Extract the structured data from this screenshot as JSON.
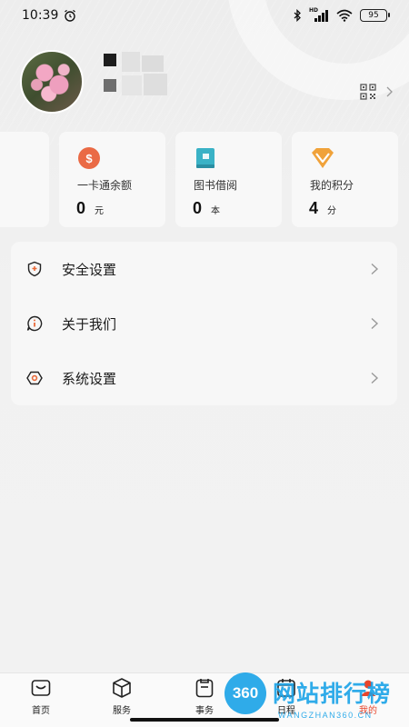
{
  "status_bar": {
    "time": "10:39",
    "battery": "95",
    "network_badge": "HD"
  },
  "profile": {
    "avatar_description": "pink-flowers-photo"
  },
  "stats": [
    {
      "label": "一卡通余额",
      "value": "0",
      "unit": "元",
      "icon": "coin-icon",
      "color": "#ea6a45"
    },
    {
      "label": "图书借阅",
      "value": "0",
      "unit": "本",
      "icon": "book-icon",
      "color": "#3ab2c6"
    },
    {
      "label": "我的积分",
      "value": "4",
      "unit": "分",
      "icon": "gem-icon",
      "color": "#f0a23a"
    }
  ],
  "menu": {
    "items": [
      {
        "label": "安全设置",
        "icon": "shield-icon"
      },
      {
        "label": "关于我们",
        "icon": "info-bubble-icon"
      },
      {
        "label": "系统设置",
        "icon": "settings-hex-icon"
      }
    ]
  },
  "bottom_nav": {
    "items": [
      {
        "label": "首页",
        "icon": "home-icon"
      },
      {
        "label": "服务",
        "icon": "cube-icon"
      },
      {
        "label": "事务",
        "icon": "clipboard-icon"
      },
      {
        "label": "日程",
        "icon": "calendar-icon"
      },
      {
        "label": "我的",
        "icon": "profile-icon",
        "active": true
      }
    ],
    "active_color": "#e8452c"
  },
  "watermark": {
    "badge": "360",
    "title": "网站排行榜",
    "subtitle": "WANGZHAN360.CN"
  }
}
